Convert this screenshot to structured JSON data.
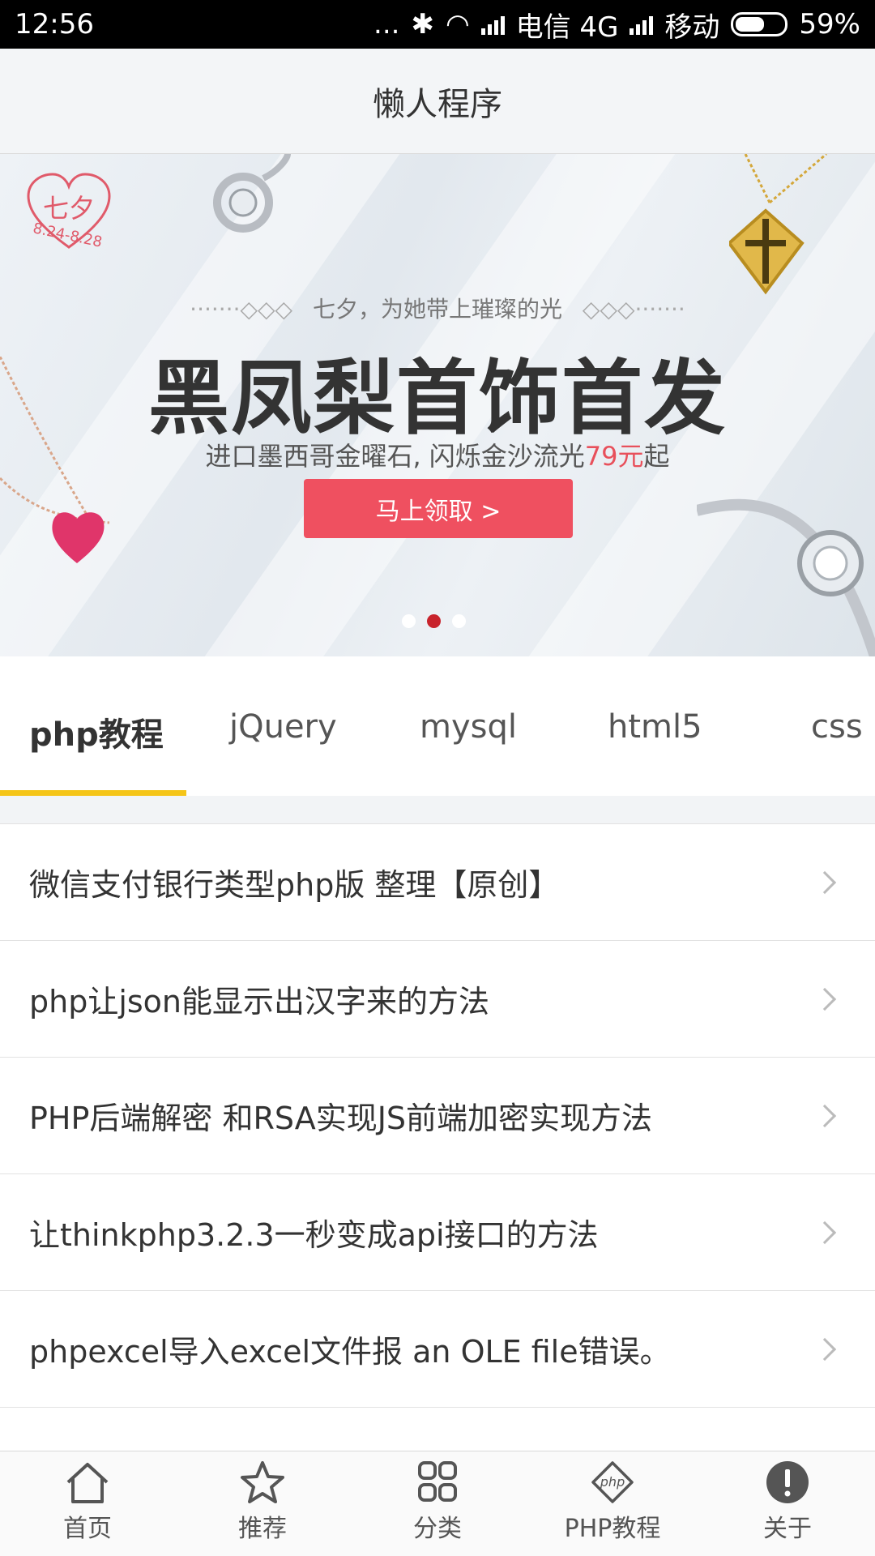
{
  "status_bar": {
    "time": "12:56",
    "dots": "...",
    "carrier1": "电信 4G",
    "carrier2": "移动",
    "battery": "59%",
    "battery_level": 0.59
  },
  "header": {
    "title": "懒人程序"
  },
  "banner": {
    "tag_text": "七夕",
    "tag_date": "8.24-8.28",
    "subtitle": "七夕，为她带上璀璨的光",
    "subtitle_deco_left": "·······◇◇◇",
    "subtitle_deco_right": "◇◇◇·······",
    "title": "黑凤梨首饰首发",
    "desc_prefix": "进口墨西哥金曜石, 闪烁金沙流光",
    "desc_price": "79元",
    "desc_suffix": "起",
    "cta": "马上领取 >",
    "slide_count": 3,
    "active_slide": 2
  },
  "tabs": [
    {
      "label": "php教程",
      "active": true
    },
    {
      "label": "jQuery",
      "active": false
    },
    {
      "label": "mysql",
      "active": false
    },
    {
      "label": "html5",
      "active": false
    },
    {
      "label": "css",
      "active": false
    }
  ],
  "articles": [
    {
      "title": "微信支付银行类型php版 整理【原创】"
    },
    {
      "title": "php让json能显示出汉字来的方法"
    },
    {
      "title": "PHP后端解密 和RSA实现JS前端加密实现方法"
    },
    {
      "title": "让thinkphp3.2.3一秒变成api接口的方法"
    },
    {
      "title": "phpexcel导入excel文件报 an OLE file错误。"
    }
  ],
  "bottom_nav": [
    {
      "label": "首页",
      "icon": "home-icon"
    },
    {
      "label": "推荐",
      "icon": "star-icon"
    },
    {
      "label": "分类",
      "icon": "grid-icon"
    },
    {
      "label": "PHP教程",
      "icon": "php-icon"
    },
    {
      "label": "关于",
      "icon": "info-icon"
    }
  ],
  "colors": {
    "accent": "#f5c518",
    "cta": "#ef5060",
    "price": "#e8505b",
    "active_dot": "#c8232c"
  }
}
